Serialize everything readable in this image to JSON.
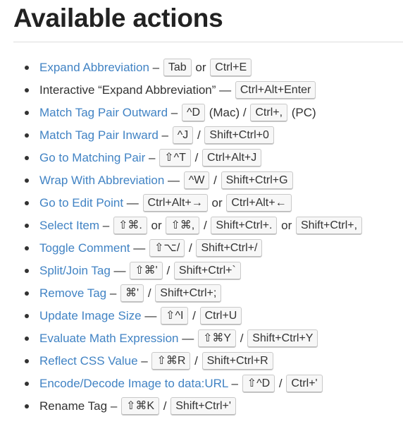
{
  "page_title": "Available actions",
  "actions": [
    {
      "name": "Expand Abbreviation",
      "link": true,
      "parts": [
        {
          "t": "text",
          "v": " – "
        },
        {
          "t": "kbd",
          "v": "Tab"
        },
        {
          "t": "text",
          "v": " or "
        },
        {
          "t": "kbd",
          "v": "Ctrl+E"
        }
      ]
    },
    {
      "name": "Interactive “Expand Abbreviation”",
      "link": false,
      "parts": [
        {
          "t": "text",
          "v": " — "
        },
        {
          "t": "kbd",
          "v": "Ctrl+Alt+Enter"
        }
      ]
    },
    {
      "name": "Match Tag Pair Outward",
      "link": true,
      "parts": [
        {
          "t": "text",
          "v": " – "
        },
        {
          "t": "kbd",
          "v": "^D"
        },
        {
          "t": "text",
          "v": " (Mac) / "
        },
        {
          "t": "kbd",
          "v": "Ctrl+,"
        },
        {
          "t": "text",
          "v": " (PC)"
        }
      ]
    },
    {
      "name": "Match Tag Pair Inward",
      "link": true,
      "parts": [
        {
          "t": "text",
          "v": " – "
        },
        {
          "t": "kbd",
          "v": "^J"
        },
        {
          "t": "text",
          "v": " / "
        },
        {
          "t": "kbd",
          "v": "Shift+Ctrl+0"
        }
      ]
    },
    {
      "name": "Go to Matching Pair",
      "link": true,
      "parts": [
        {
          "t": "text",
          "v": " – "
        },
        {
          "t": "kbd",
          "v": "⇧^T"
        },
        {
          "t": "text",
          "v": " / "
        },
        {
          "t": "kbd",
          "v": "Ctrl+Alt+J"
        }
      ]
    },
    {
      "name": "Wrap With Abbreviation",
      "link": true,
      "parts": [
        {
          "t": "text",
          "v": " — "
        },
        {
          "t": "kbd",
          "v": "^W"
        },
        {
          "t": "text",
          "v": " / "
        },
        {
          "t": "kbd",
          "v": "Shift+Ctrl+G"
        }
      ]
    },
    {
      "name": "Go to Edit Point",
      "link": true,
      "parts": [
        {
          "t": "text",
          "v": " — "
        },
        {
          "t": "kbd",
          "v": "Ctrl+Alt+→"
        },
        {
          "t": "text",
          "v": " or "
        },
        {
          "t": "kbd",
          "v": "Ctrl+Alt+←"
        }
      ]
    },
    {
      "name": "Select Item",
      "link": true,
      "parts": [
        {
          "t": "text",
          "v": " – "
        },
        {
          "t": "kbd",
          "v": "⇧⌘."
        },
        {
          "t": "text",
          "v": " or "
        },
        {
          "t": "kbd",
          "v": "⇧⌘,"
        },
        {
          "t": "text",
          "v": " / "
        },
        {
          "t": "kbd",
          "v": "Shift+Ctrl+."
        },
        {
          "t": "text",
          "v": " or "
        },
        {
          "t": "kbd",
          "v": "Shift+Ctrl+,"
        }
      ]
    },
    {
      "name": "Toggle Comment",
      "link": true,
      "parts": [
        {
          "t": "text",
          "v": " — "
        },
        {
          "t": "kbd",
          "v": "⇧⌥/"
        },
        {
          "t": "text",
          "v": " / "
        },
        {
          "t": "kbd",
          "v": "Shift+Ctrl+/"
        }
      ]
    },
    {
      "name": "Split/Join Tag",
      "link": true,
      "parts": [
        {
          "t": "text",
          "v": " — "
        },
        {
          "t": "kbd",
          "v": "⇧⌘'"
        },
        {
          "t": "text",
          "v": " / "
        },
        {
          "t": "kbd",
          "v": "Shift+Ctrl+`"
        }
      ]
    },
    {
      "name": "Remove Tag",
      "link": true,
      "parts": [
        {
          "t": "text",
          "v": " – "
        },
        {
          "t": "kbd",
          "v": "⌘'"
        },
        {
          "t": "text",
          "v": " / "
        },
        {
          "t": "kbd",
          "v": "Shift+Ctrl+;"
        }
      ]
    },
    {
      "name": "Update Image Size",
      "link": true,
      "parts": [
        {
          "t": "text",
          "v": " — "
        },
        {
          "t": "kbd",
          "v": "⇧^I"
        },
        {
          "t": "text",
          "v": " / "
        },
        {
          "t": "kbd",
          "v": "Ctrl+U"
        }
      ]
    },
    {
      "name": "Evaluate Math Expression",
      "link": true,
      "parts": [
        {
          "t": "text",
          "v": " — "
        },
        {
          "t": "kbd",
          "v": "⇧⌘Y"
        },
        {
          "t": "text",
          "v": " / "
        },
        {
          "t": "kbd",
          "v": "Shift+Ctrl+Y"
        }
      ]
    },
    {
      "name": "Reflect CSS Value",
      "link": true,
      "parts": [
        {
          "t": "text",
          "v": " – "
        },
        {
          "t": "kbd",
          "v": "⇧⌘R"
        },
        {
          "t": "text",
          "v": " / "
        },
        {
          "t": "kbd",
          "v": "Shift+Ctrl+R"
        }
      ]
    },
    {
      "name": "Encode/Decode Image to data:URL",
      "link": true,
      "parts": [
        {
          "t": "text",
          "v": " – "
        },
        {
          "t": "kbd",
          "v": "⇧^D"
        },
        {
          "t": "text",
          "v": " / "
        },
        {
          "t": "kbd",
          "v": "Ctrl+'"
        }
      ]
    },
    {
      "name": "Rename Tag",
      "link": false,
      "parts": [
        {
          "t": "text",
          "v": " – "
        },
        {
          "t": "kbd",
          "v": "⇧⌘K"
        },
        {
          "t": "text",
          "v": " / "
        },
        {
          "t": "kbd",
          "v": "Shift+Ctrl+'"
        }
      ]
    }
  ],
  "colors": {
    "link": "#4183c4",
    "text": "#333333",
    "heading": "#222222",
    "kbd_bg": "#f7f7f7",
    "kbd_border": "#c9c9c9"
  }
}
